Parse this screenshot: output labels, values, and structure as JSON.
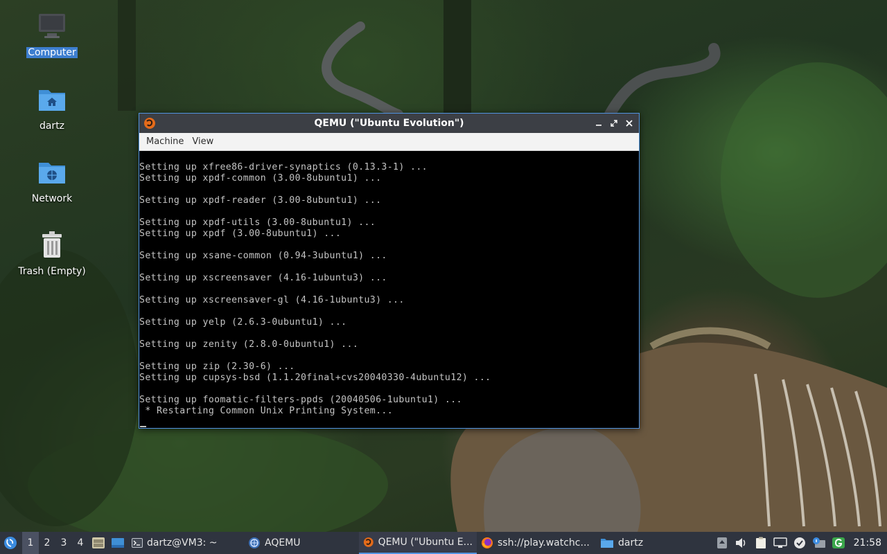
{
  "desktop": {
    "icons": [
      {
        "label": "Computer",
        "icon": "computer-icon"
      },
      {
        "label": "dartz",
        "icon": "home-folder-icon"
      },
      {
        "label": "Network",
        "icon": "network-folder-icon"
      },
      {
        "label": "Trash (Empty)",
        "icon": "trash-icon"
      }
    ]
  },
  "window": {
    "title": "QEMU (\"Ubuntu Evolution\")",
    "menu": [
      "Machine",
      "View"
    ],
    "console_lines": [
      "Setting up xfree86-driver-synaptics (0.13.3-1) ...",
      "Setting up xpdf-common (3.00-8ubuntu1) ...",
      "",
      "Setting up xpdf-reader (3.00-8ubuntu1) ...",
      "",
      "Setting up xpdf-utils (3.00-8ubuntu1) ...",
      "Setting up xpdf (3.00-8ubuntu1) ...",
      "",
      "Setting up xsane-common (0.94-3ubuntu1) ...",
      "",
      "Setting up xscreensaver (4.16-1ubuntu3) ...",
      "",
      "Setting up xscreensaver-gl (4.16-1ubuntu3) ...",
      "",
      "Setting up yelp (2.6.3-0ubuntu1) ...",
      "",
      "Setting up zenity (2.8.0-0ubuntu1) ...",
      "",
      "Setting up zip (2.30-6) ...",
      "Setting up cupsys-bsd (1.1.20final+cvs20040330-4ubuntu12) ...",
      "",
      "Setting up foomatic-filters-ppds (20040506-1ubuntu1) ...",
      " * Restarting Common Unix Printing System..."
    ]
  },
  "taskbar": {
    "workspaces": [
      "1",
      "2",
      "3",
      "4"
    ],
    "active_workspace": "1",
    "tasks": [
      {
        "label": "dartz@VM3: ~",
        "icon": "terminal-icon"
      },
      {
        "label": "AQEMU",
        "icon": "aqemu-icon"
      },
      {
        "label": "QEMU (\"Ubuntu E...",
        "icon": "qemu-icon",
        "active": true
      },
      {
        "label": "ssh://play.watchc...",
        "icon": "firefox-icon"
      },
      {
        "label": "dartz",
        "icon": "folder-icon"
      }
    ],
    "clock": "21:58",
    "colors": {
      "panel": "#2f343f",
      "accent": "#5294e2"
    }
  }
}
